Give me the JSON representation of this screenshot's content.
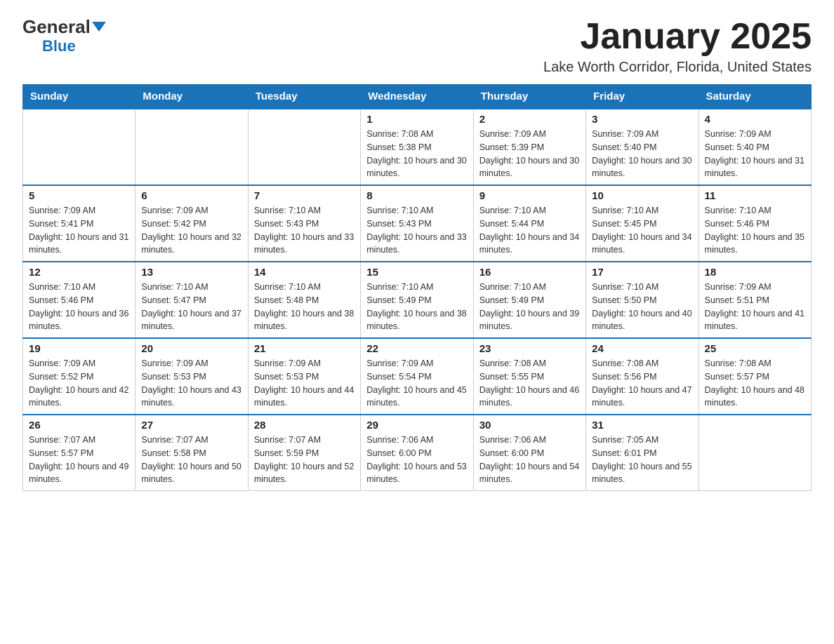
{
  "logo": {
    "general": "General",
    "triangle": "▶",
    "blue": "Blue"
  },
  "header": {
    "month": "January 2025",
    "location": "Lake Worth Corridor, Florida, United States"
  },
  "weekdays": [
    "Sunday",
    "Monday",
    "Tuesday",
    "Wednesday",
    "Thursday",
    "Friday",
    "Saturday"
  ],
  "weeks": [
    [
      {
        "day": "",
        "sunrise": "",
        "sunset": "",
        "daylight": ""
      },
      {
        "day": "",
        "sunrise": "",
        "sunset": "",
        "daylight": ""
      },
      {
        "day": "",
        "sunrise": "",
        "sunset": "",
        "daylight": ""
      },
      {
        "day": "1",
        "sunrise": "Sunrise: 7:08 AM",
        "sunset": "Sunset: 5:38 PM",
        "daylight": "Daylight: 10 hours and 30 minutes."
      },
      {
        "day": "2",
        "sunrise": "Sunrise: 7:09 AM",
        "sunset": "Sunset: 5:39 PM",
        "daylight": "Daylight: 10 hours and 30 minutes."
      },
      {
        "day": "3",
        "sunrise": "Sunrise: 7:09 AM",
        "sunset": "Sunset: 5:40 PM",
        "daylight": "Daylight: 10 hours and 30 minutes."
      },
      {
        "day": "4",
        "sunrise": "Sunrise: 7:09 AM",
        "sunset": "Sunset: 5:40 PM",
        "daylight": "Daylight: 10 hours and 31 minutes."
      }
    ],
    [
      {
        "day": "5",
        "sunrise": "Sunrise: 7:09 AM",
        "sunset": "Sunset: 5:41 PM",
        "daylight": "Daylight: 10 hours and 31 minutes."
      },
      {
        "day": "6",
        "sunrise": "Sunrise: 7:09 AM",
        "sunset": "Sunset: 5:42 PM",
        "daylight": "Daylight: 10 hours and 32 minutes."
      },
      {
        "day": "7",
        "sunrise": "Sunrise: 7:10 AM",
        "sunset": "Sunset: 5:43 PM",
        "daylight": "Daylight: 10 hours and 33 minutes."
      },
      {
        "day": "8",
        "sunrise": "Sunrise: 7:10 AM",
        "sunset": "Sunset: 5:43 PM",
        "daylight": "Daylight: 10 hours and 33 minutes."
      },
      {
        "day": "9",
        "sunrise": "Sunrise: 7:10 AM",
        "sunset": "Sunset: 5:44 PM",
        "daylight": "Daylight: 10 hours and 34 minutes."
      },
      {
        "day": "10",
        "sunrise": "Sunrise: 7:10 AM",
        "sunset": "Sunset: 5:45 PM",
        "daylight": "Daylight: 10 hours and 34 minutes."
      },
      {
        "day": "11",
        "sunrise": "Sunrise: 7:10 AM",
        "sunset": "Sunset: 5:46 PM",
        "daylight": "Daylight: 10 hours and 35 minutes."
      }
    ],
    [
      {
        "day": "12",
        "sunrise": "Sunrise: 7:10 AM",
        "sunset": "Sunset: 5:46 PM",
        "daylight": "Daylight: 10 hours and 36 minutes."
      },
      {
        "day": "13",
        "sunrise": "Sunrise: 7:10 AM",
        "sunset": "Sunset: 5:47 PM",
        "daylight": "Daylight: 10 hours and 37 minutes."
      },
      {
        "day": "14",
        "sunrise": "Sunrise: 7:10 AM",
        "sunset": "Sunset: 5:48 PM",
        "daylight": "Daylight: 10 hours and 38 minutes."
      },
      {
        "day": "15",
        "sunrise": "Sunrise: 7:10 AM",
        "sunset": "Sunset: 5:49 PM",
        "daylight": "Daylight: 10 hours and 38 minutes."
      },
      {
        "day": "16",
        "sunrise": "Sunrise: 7:10 AM",
        "sunset": "Sunset: 5:49 PM",
        "daylight": "Daylight: 10 hours and 39 minutes."
      },
      {
        "day": "17",
        "sunrise": "Sunrise: 7:10 AM",
        "sunset": "Sunset: 5:50 PM",
        "daylight": "Daylight: 10 hours and 40 minutes."
      },
      {
        "day": "18",
        "sunrise": "Sunrise: 7:09 AM",
        "sunset": "Sunset: 5:51 PM",
        "daylight": "Daylight: 10 hours and 41 minutes."
      }
    ],
    [
      {
        "day": "19",
        "sunrise": "Sunrise: 7:09 AM",
        "sunset": "Sunset: 5:52 PM",
        "daylight": "Daylight: 10 hours and 42 minutes."
      },
      {
        "day": "20",
        "sunrise": "Sunrise: 7:09 AM",
        "sunset": "Sunset: 5:53 PM",
        "daylight": "Daylight: 10 hours and 43 minutes."
      },
      {
        "day": "21",
        "sunrise": "Sunrise: 7:09 AM",
        "sunset": "Sunset: 5:53 PM",
        "daylight": "Daylight: 10 hours and 44 minutes."
      },
      {
        "day": "22",
        "sunrise": "Sunrise: 7:09 AM",
        "sunset": "Sunset: 5:54 PM",
        "daylight": "Daylight: 10 hours and 45 minutes."
      },
      {
        "day": "23",
        "sunrise": "Sunrise: 7:08 AM",
        "sunset": "Sunset: 5:55 PM",
        "daylight": "Daylight: 10 hours and 46 minutes."
      },
      {
        "day": "24",
        "sunrise": "Sunrise: 7:08 AM",
        "sunset": "Sunset: 5:56 PM",
        "daylight": "Daylight: 10 hours and 47 minutes."
      },
      {
        "day": "25",
        "sunrise": "Sunrise: 7:08 AM",
        "sunset": "Sunset: 5:57 PM",
        "daylight": "Daylight: 10 hours and 48 minutes."
      }
    ],
    [
      {
        "day": "26",
        "sunrise": "Sunrise: 7:07 AM",
        "sunset": "Sunset: 5:57 PM",
        "daylight": "Daylight: 10 hours and 49 minutes."
      },
      {
        "day": "27",
        "sunrise": "Sunrise: 7:07 AM",
        "sunset": "Sunset: 5:58 PM",
        "daylight": "Daylight: 10 hours and 50 minutes."
      },
      {
        "day": "28",
        "sunrise": "Sunrise: 7:07 AM",
        "sunset": "Sunset: 5:59 PM",
        "daylight": "Daylight: 10 hours and 52 minutes."
      },
      {
        "day": "29",
        "sunrise": "Sunrise: 7:06 AM",
        "sunset": "Sunset: 6:00 PM",
        "daylight": "Daylight: 10 hours and 53 minutes."
      },
      {
        "day": "30",
        "sunrise": "Sunrise: 7:06 AM",
        "sunset": "Sunset: 6:00 PM",
        "daylight": "Daylight: 10 hours and 54 minutes."
      },
      {
        "day": "31",
        "sunrise": "Sunrise: 7:05 AM",
        "sunset": "Sunset: 6:01 PM",
        "daylight": "Daylight: 10 hours and 55 minutes."
      },
      {
        "day": "",
        "sunrise": "",
        "sunset": "",
        "daylight": ""
      }
    ]
  ]
}
